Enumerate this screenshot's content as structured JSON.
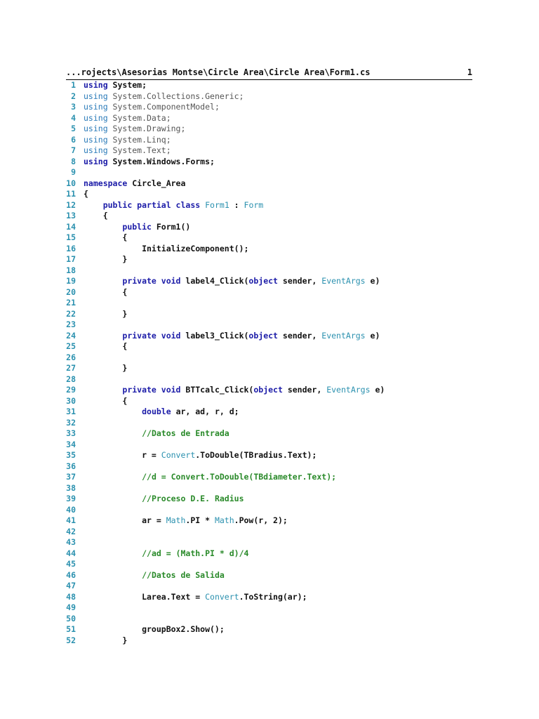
{
  "header": {
    "path": "...rojects\\Asesorias Montse\\Circle Area\\Circle Area\\Form1.cs",
    "page_number": "1"
  },
  "lines": [
    {
      "n": "1",
      "tokens": [
        [
          "kw",
          "using"
        ],
        [
          "t",
          " System;"
        ]
      ]
    },
    {
      "n": "2",
      "tokens": [
        [
          "kwl",
          "using"
        ],
        [
          "gr",
          " System.Collections.Generic;"
        ]
      ]
    },
    {
      "n": "3",
      "tokens": [
        [
          "kwl",
          "using"
        ],
        [
          "gr",
          " System.ComponentModel;"
        ]
      ]
    },
    {
      "n": "4",
      "tokens": [
        [
          "kwl",
          "using"
        ],
        [
          "gr",
          " System.Data;"
        ]
      ]
    },
    {
      "n": "5",
      "tokens": [
        [
          "kwl",
          "using"
        ],
        [
          "gr",
          " System.Drawing;"
        ]
      ]
    },
    {
      "n": "6",
      "tokens": [
        [
          "kwl",
          "using"
        ],
        [
          "gr",
          " System.Linq;"
        ]
      ]
    },
    {
      "n": "7",
      "tokens": [
        [
          "kwl",
          "using"
        ],
        [
          "gr",
          " System.Text;"
        ]
      ]
    },
    {
      "n": "8",
      "tokens": [
        [
          "kw",
          "using"
        ],
        [
          "t",
          " System.Windows.Forms;"
        ]
      ]
    },
    {
      "n": "9",
      "tokens": []
    },
    {
      "n": "10",
      "tokens": [
        [
          "kw",
          "namespace"
        ],
        [
          "t",
          " Circle_Area"
        ]
      ]
    },
    {
      "n": "11",
      "tokens": [
        [
          "t",
          "{"
        ]
      ]
    },
    {
      "n": "12",
      "tokens": [
        [
          "t",
          "    "
        ],
        [
          "kw",
          "public partial class"
        ],
        [
          "t",
          " "
        ],
        [
          "ty",
          "Form1"
        ],
        [
          "t",
          " : "
        ],
        [
          "ty",
          "Form"
        ]
      ]
    },
    {
      "n": "13",
      "tokens": [
        [
          "t",
          "    {"
        ]
      ]
    },
    {
      "n": "14",
      "tokens": [
        [
          "t",
          "        "
        ],
        [
          "kw",
          "public"
        ],
        [
          "t",
          " Form1()"
        ]
      ]
    },
    {
      "n": "15",
      "tokens": [
        [
          "t",
          "        {"
        ]
      ]
    },
    {
      "n": "16",
      "tokens": [
        [
          "t",
          "            InitializeComponent();"
        ]
      ]
    },
    {
      "n": "17",
      "tokens": [
        [
          "t",
          "        }"
        ]
      ]
    },
    {
      "n": "18",
      "tokens": []
    },
    {
      "n": "19",
      "tokens": [
        [
          "t",
          "        "
        ],
        [
          "kw",
          "private void"
        ],
        [
          "t",
          " label4_Click("
        ],
        [
          "kw",
          "object"
        ],
        [
          "t",
          " sender, "
        ],
        [
          "ty",
          "EventArgs"
        ],
        [
          "t",
          " e)"
        ]
      ]
    },
    {
      "n": "20",
      "tokens": [
        [
          "t",
          "        {"
        ]
      ]
    },
    {
      "n": "21",
      "tokens": []
    },
    {
      "n": "22",
      "tokens": [
        [
          "t",
          "        }"
        ]
      ]
    },
    {
      "n": "23",
      "tokens": []
    },
    {
      "n": "24",
      "tokens": [
        [
          "t",
          "        "
        ],
        [
          "kw",
          "private void"
        ],
        [
          "t",
          " label3_Click("
        ],
        [
          "kw",
          "object"
        ],
        [
          "t",
          " sender, "
        ],
        [
          "ty",
          "EventArgs"
        ],
        [
          "t",
          " e)"
        ]
      ]
    },
    {
      "n": "25",
      "tokens": [
        [
          "t",
          "        {"
        ]
      ]
    },
    {
      "n": "26",
      "tokens": []
    },
    {
      "n": "27",
      "tokens": [
        [
          "t",
          "        }"
        ]
      ]
    },
    {
      "n": "28",
      "tokens": []
    },
    {
      "n": "29",
      "tokens": [
        [
          "t",
          "        "
        ],
        [
          "kw",
          "private void"
        ],
        [
          "t",
          " BTTcalc_Click("
        ],
        [
          "kw",
          "object"
        ],
        [
          "t",
          " sender, "
        ],
        [
          "ty",
          "EventArgs"
        ],
        [
          "t",
          " e)"
        ]
      ]
    },
    {
      "n": "30",
      "tokens": [
        [
          "t",
          "        {"
        ]
      ]
    },
    {
      "n": "31",
      "tokens": [
        [
          "t",
          "            "
        ],
        [
          "kw",
          "double"
        ],
        [
          "t",
          " ar, ad, r, d;"
        ]
      ]
    },
    {
      "n": "32",
      "tokens": []
    },
    {
      "n": "33",
      "tokens": [
        [
          "t",
          "            "
        ],
        [
          "cm",
          "//Datos de Entrada"
        ]
      ]
    },
    {
      "n": "34",
      "tokens": []
    },
    {
      "n": "35",
      "tokens": [
        [
          "t",
          "            r = "
        ],
        [
          "ty",
          "Convert"
        ],
        [
          "t",
          ".ToDouble(TBradius.Text);"
        ]
      ]
    },
    {
      "n": "36",
      "tokens": []
    },
    {
      "n": "37",
      "tokens": [
        [
          "t",
          "            "
        ],
        [
          "cm",
          "//d = Convert.ToDouble(TBdiameter.Text);"
        ]
      ]
    },
    {
      "n": "38",
      "tokens": []
    },
    {
      "n": "39",
      "tokens": [
        [
          "t",
          "            "
        ],
        [
          "cm",
          "//Proceso D.E. Radius"
        ]
      ]
    },
    {
      "n": "40",
      "tokens": []
    },
    {
      "n": "41",
      "tokens": [
        [
          "t",
          "            ar = "
        ],
        [
          "ty",
          "Math"
        ],
        [
          "t",
          ".PI * "
        ],
        [
          "ty",
          "Math"
        ],
        [
          "t",
          ".Pow(r, 2);"
        ]
      ]
    },
    {
      "n": "42",
      "tokens": []
    },
    {
      "n": "43",
      "tokens": []
    },
    {
      "n": "44",
      "tokens": [
        [
          "t",
          "            "
        ],
        [
          "cm",
          "//ad = (Math.PI * d)/4"
        ]
      ]
    },
    {
      "n": "45",
      "tokens": []
    },
    {
      "n": "46",
      "tokens": [
        [
          "t",
          "            "
        ],
        [
          "cm",
          "//Datos de Salida"
        ]
      ]
    },
    {
      "n": "47",
      "tokens": []
    },
    {
      "n": "48",
      "tokens": [
        [
          "t",
          "            Larea.Text = "
        ],
        [
          "ty",
          "Convert"
        ],
        [
          "t",
          ".ToString(ar);"
        ]
      ]
    },
    {
      "n": "49",
      "tokens": []
    },
    {
      "n": "50",
      "tokens": []
    },
    {
      "n": "51",
      "tokens": [
        [
          "t",
          "            groupBox2.Show();"
        ]
      ]
    },
    {
      "n": "52",
      "tokens": [
        [
          "t",
          "        }"
        ]
      ]
    }
  ]
}
